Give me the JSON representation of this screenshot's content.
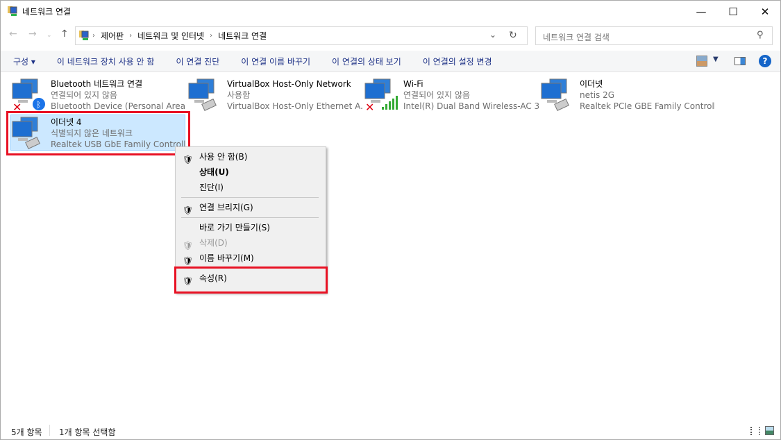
{
  "window": {
    "title": "네트워크 연결",
    "minimize": "—",
    "maximize": "☐",
    "close": "✕"
  },
  "address": {
    "crumbs": [
      "제어판",
      "네트워크 및 인터넷",
      "네트워크 연결"
    ],
    "search_placeholder": "네트워크 연결 검색"
  },
  "toolbar": {
    "organize": "구성 ▾",
    "items": [
      "이 네트워크 장치 사용 안 함",
      "이 연결 진단",
      "이 연결 이름 바꾸기",
      "이 연결의 상태 보기",
      "이 연결의 설정 변경"
    ]
  },
  "connections": [
    {
      "name": "Bluetooth 네트워크 연결",
      "status": "연결되어 있지 않음",
      "device": "Bluetooth Device (Personal Area ...",
      "badge": "bluetooth-disconnected"
    },
    {
      "name": "VirtualBox Host-Only Network",
      "status": "사용함",
      "device": "VirtualBox Host-Only Ethernet A...",
      "badge": "ethernet"
    },
    {
      "name": "Wi-Fi",
      "status": "연결되어 있지 않음",
      "device": "Intel(R) Dual Band Wireless-AC 3...",
      "badge": "wifi-disconnected"
    },
    {
      "name": "이더넷",
      "status": "netis 2G",
      "device": "Realtek PCIe GBE Family Controller",
      "badge": "ethernet"
    },
    {
      "name": "이더넷 4",
      "status": "식별되지 않은 네트워크",
      "device": "Realtek USB GbE Family Controller",
      "badge": "ethernet",
      "selected": true
    }
  ],
  "context_menu": [
    {
      "label": "사용 안 함(B)",
      "shield": true
    },
    {
      "label": "상태(U)",
      "bold": true
    },
    {
      "label": "진단(I)"
    },
    {
      "label": "연결 브리지(G)",
      "shield": true
    },
    {
      "label": "바로 가기 만들기(S)"
    },
    {
      "label": "삭제(D)",
      "shield": true,
      "disabled": true
    },
    {
      "label": "이름 바꾸기(M)",
      "shield": true
    },
    {
      "label": "속성(R)",
      "shield": true,
      "highlighted": true
    }
  ],
  "statusbar": {
    "count": "5개 항목",
    "selected": "1개 항목 선택함"
  },
  "colors": {
    "highlight": "#e81123",
    "selection": "#cce8ff",
    "link": "#1e3287"
  }
}
